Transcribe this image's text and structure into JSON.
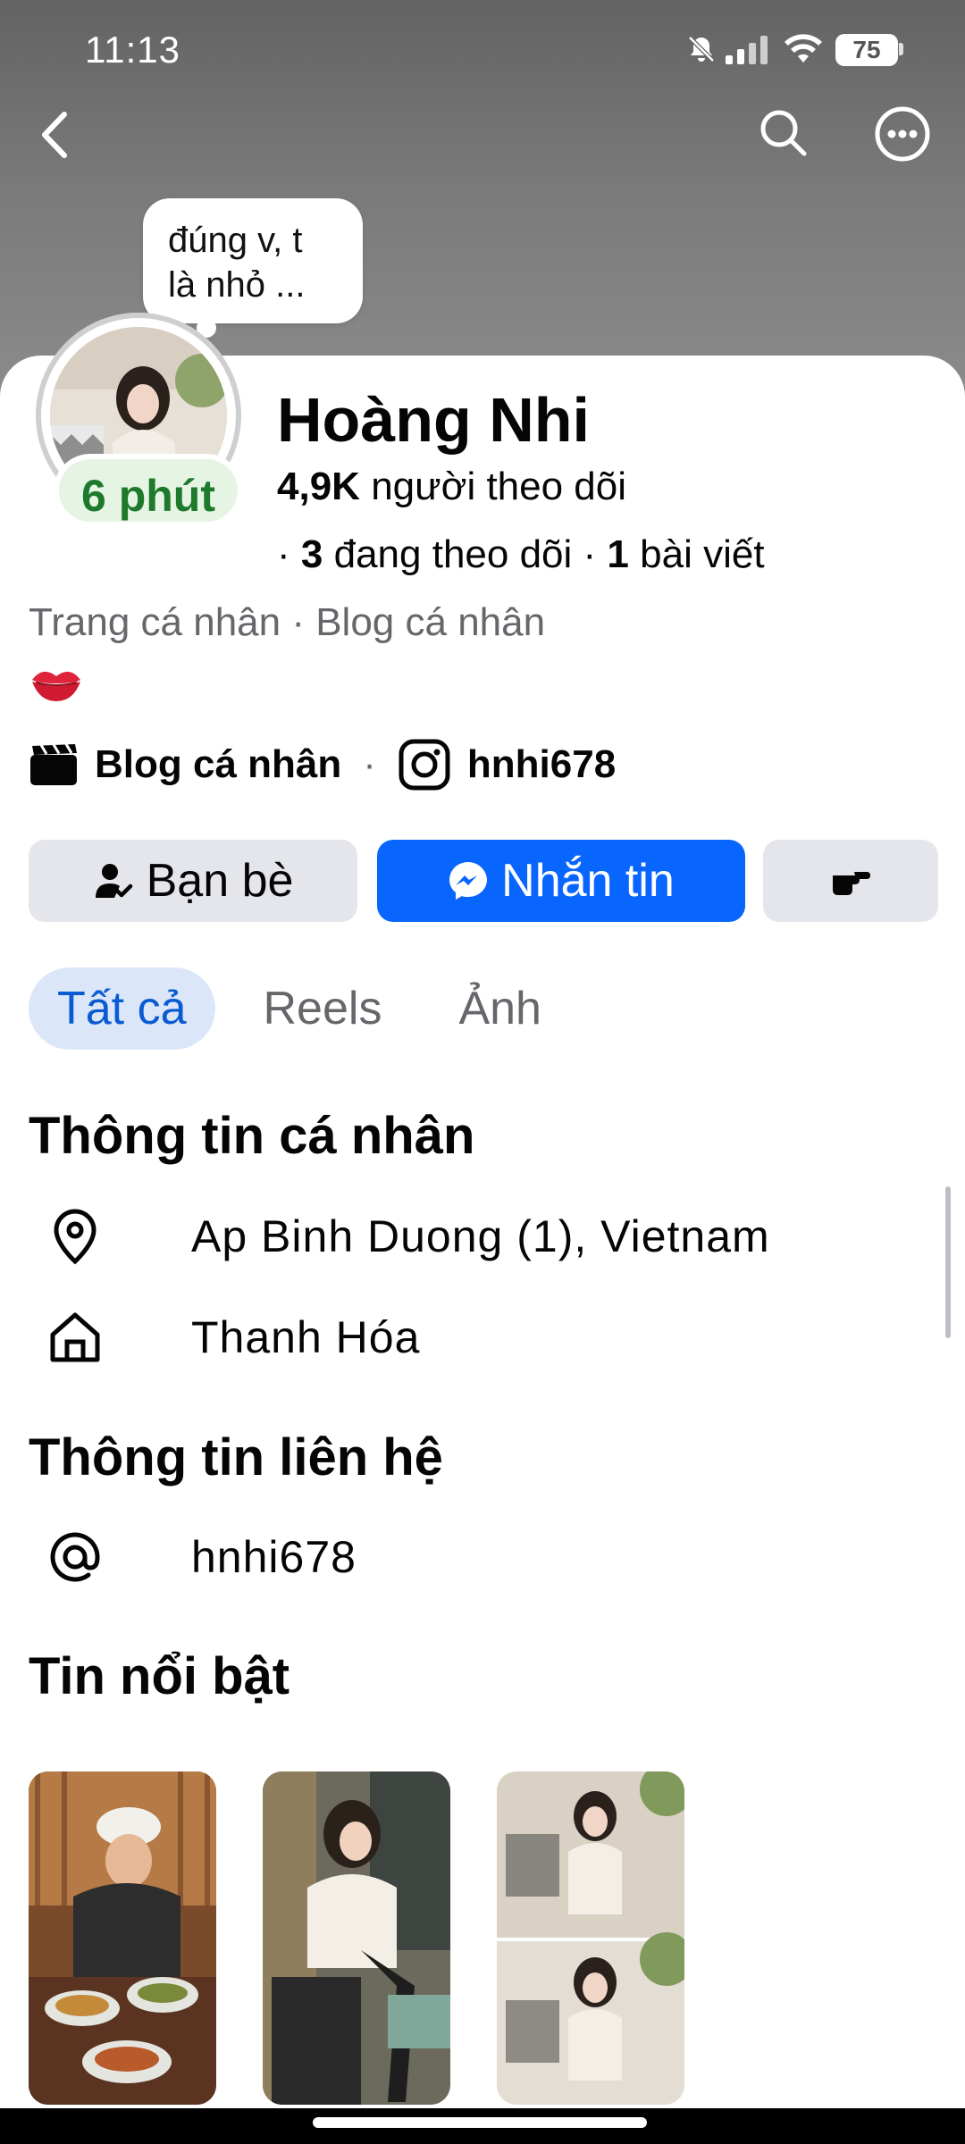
{
  "status_bar": {
    "time": "11:13",
    "battery": "75"
  },
  "story_bubble": {
    "text_line1": "đúng v, t",
    "text_line2": "là nhỏ ..."
  },
  "profile": {
    "name": "Hoàng Nhi",
    "active_badge": "6 phút",
    "followers_count": "4,9K",
    "followers_label": "người theo dõi",
    "following_prefix": "·",
    "following_count": "3",
    "following_label": "đang theo dõi ·",
    "posts_count": "1",
    "posts_label": "bài viết",
    "category": "Trang cá nhân · Blog cá nhân",
    "bio_emoji": "💋",
    "link_blog": "Blog cá nhân",
    "link_sep": "·",
    "instagram": "hnhi678"
  },
  "actions": {
    "friends": "Bạn bè",
    "message": "Nhắn tin"
  },
  "tabs": [
    {
      "label": "Tất cả",
      "active": true
    },
    {
      "label": "Reels",
      "active": false
    },
    {
      "label": "Ảnh",
      "active": false
    }
  ],
  "personal_info": {
    "title": "Thông tin cá nhân",
    "location": "Ap Binh Duong (1), Vietnam",
    "hometown": "Thanh Hóa"
  },
  "contact_info": {
    "title": "Thông tin liên hệ",
    "username": "hnhi678"
  },
  "featured": {
    "title": "Tin nổi bật"
  },
  "colors": {
    "primary": "#0866ff",
    "active_green": "#1d7a2c",
    "secondary_text": "#65676b",
    "button_grey": "#e4e6eb"
  }
}
